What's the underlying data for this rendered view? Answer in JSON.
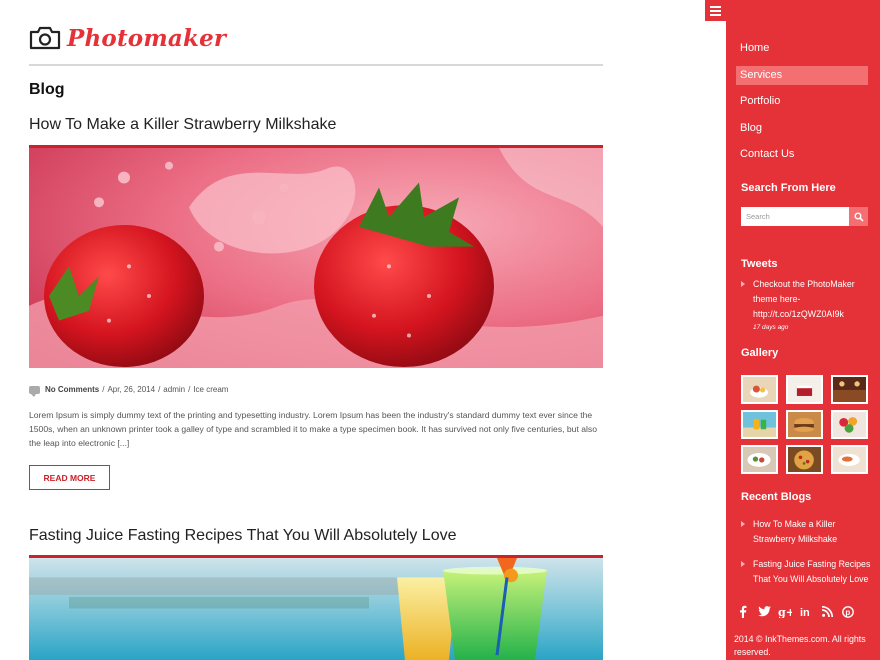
{
  "header": {
    "brand": "Photomaker",
    "page_title": "Blog"
  },
  "posts": [
    {
      "title": "How To Make a Killer Strawberry Milkshake",
      "meta": {
        "comments": "No Comments",
        "date": "Apr, 26, 2014",
        "author": "admin",
        "category": "Ice cream"
      },
      "excerpt": "Lorem Ipsum is simply dummy text of the printing and typesetting industry. Lorem Ipsum has been the industry's standard dummy text ever since the 1500s, when an unknown printer took a galley of type and scrambled it to make a type specimen book. It has survived not only five centuries, but also the leap into electronic [...]",
      "read_more": "READ MORE"
    },
    {
      "title": "Fasting Juice Fasting Recipes That You Will Absolutely Love"
    }
  ],
  "sidebar": {
    "nav": [
      "Home",
      "Services",
      "Portfolio",
      "Blog",
      "Contact Us"
    ],
    "active_nav": "Services",
    "search_heading": "Search From Here",
    "search_placeholder": "Search",
    "tweets_heading": "Tweets",
    "tweet": {
      "line1": "Checkout the PhotoMaker",
      "line2": "theme here-",
      "line3": "http://t.co/1zQWZ0AI9k",
      "ago": "17 days ago"
    },
    "gallery_heading": "Gallery",
    "gallery_icons": [
      "dessert-photo",
      "cake-photo",
      "restaurant-photo",
      "beach-drinks-photo",
      "burger-photo",
      "fruit-bowl-photo",
      "salad-photo",
      "pizza-photo",
      "seafood-photo"
    ],
    "recent_heading": "Recent Blogs",
    "recent": [
      {
        "line1": "How To Make a Killer",
        "line2": "Strawberry Milkshake"
      },
      {
        "line1": "Fasting Juice Fasting Recipes",
        "line2": "That You Will Absolutely Love"
      }
    ],
    "social": [
      "f",
      "t",
      "g+",
      "in",
      "rss",
      "p"
    ],
    "copyright_line1": "2014 © InkThemes.com. All rights",
    "copyright_line2": "reserved."
  },
  "colors": {
    "accent": "#e53238",
    "accent_light": "#f46f72",
    "rule": "#c8232a"
  }
}
